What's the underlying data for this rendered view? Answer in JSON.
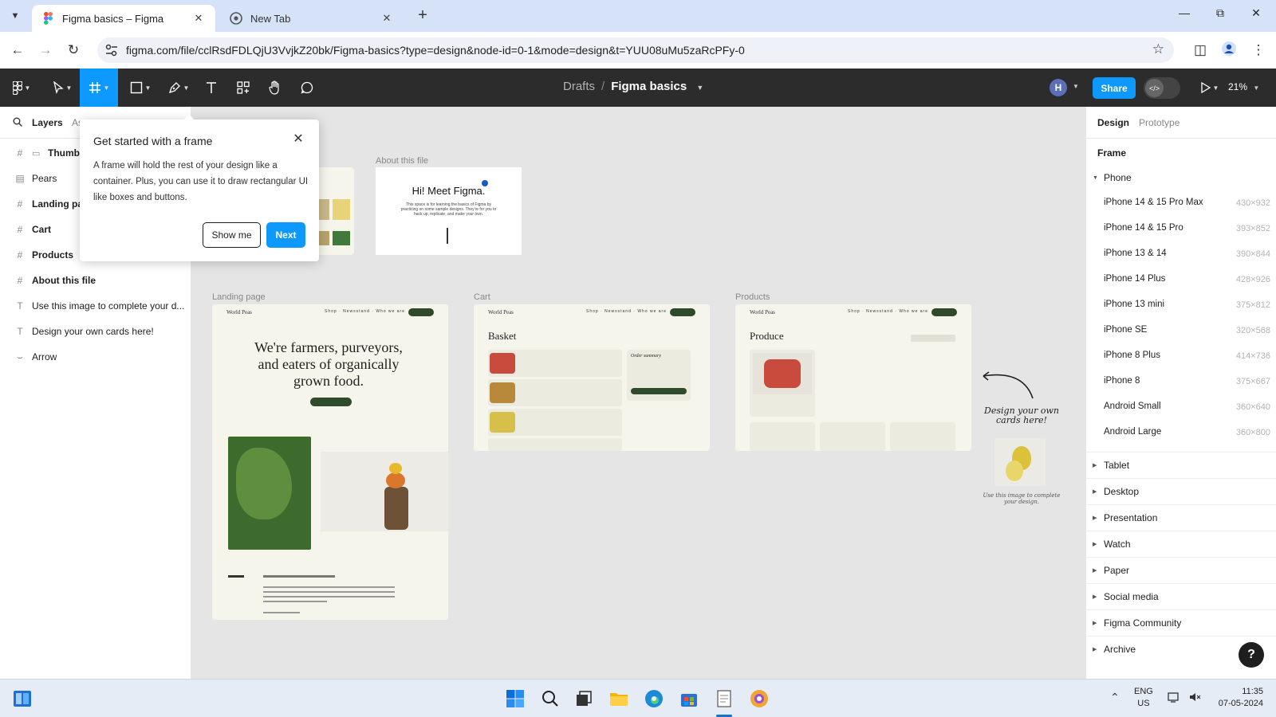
{
  "browser": {
    "tabs": [
      {
        "title": "Figma basics – Figma",
        "active": true
      },
      {
        "title": "New Tab",
        "active": false
      }
    ],
    "url": "figma.com/file/cclRsdFDLQjU3VvjkZ20bk/Figma-basics?type=design&node-id=0-1&mode=design&t=YUU08uMu5zaRcPFy-0"
  },
  "toolbar": {
    "breadcrumb_parent": "Drafts",
    "breadcrumb_separator": "/",
    "file_name": "Figma basics",
    "avatar_initial": "H",
    "share_label": "Share",
    "zoom": "21%",
    "accent": "#0d99ff"
  },
  "left_panel": {
    "layers_tab": "Layers",
    "assets_tab": "As",
    "layers": [
      {
        "icon": "frame-icon",
        "label": "Thumb",
        "bold": true
      },
      {
        "icon": "image-icon",
        "label": "Pears",
        "bold": false
      },
      {
        "icon": "frame-icon",
        "label": "Landing pa",
        "bold": true
      },
      {
        "icon": "frame-icon",
        "label": "Cart",
        "bold": true
      },
      {
        "icon": "frame-icon",
        "label": "Products",
        "bold": true
      },
      {
        "icon": "frame-icon",
        "label": "About this file",
        "bold": true
      },
      {
        "icon": "text-icon",
        "label": "Use this image to complete your d...",
        "bold": false
      },
      {
        "icon": "text-icon",
        "label": "Design your own cards here!",
        "bold": false
      },
      {
        "icon": "vector-icon",
        "label": "Arrow",
        "bold": false
      }
    ]
  },
  "popup": {
    "title": "Get started with a frame",
    "body": "A frame will hold the rest of your design like a container. Plus, you can use it to draw rectangular UI like boxes and buttons.",
    "show_me": "Show me",
    "next": "Next"
  },
  "canvas": {
    "about_label": "About this file",
    "about_title": "Hi! Meet Figma.",
    "about_body": "This space is for learning the basics of Figma by practicing on some sample designs. They're for you to hack up, replicate, and make your own.",
    "landing_label": "Landing page",
    "cart_label": "Cart",
    "products_label": "Products",
    "brand": "World Peas",
    "hero_line1": "We're farmers, purveyors,",
    "hero_line2": "and eaters of organically",
    "hero_line3": "grown food.",
    "basket_title": "Basket",
    "order_summary": "Order summary",
    "produce_title": "Produce",
    "cards_note": "Design your own cards here!",
    "image_note": "Use this image to complete your design."
  },
  "right_panel": {
    "design_tab": "Design",
    "prototype_tab": "Prototype",
    "section": "Frame",
    "expanded_category": "Phone",
    "presets": [
      {
        "name": "iPhone 14 & 15 Pro Max",
        "size": "430×932"
      },
      {
        "name": "iPhone 14 & 15 Pro",
        "size": "393×852"
      },
      {
        "name": "iPhone 13 & 14",
        "size": "390×844"
      },
      {
        "name": "iPhone 14 Plus",
        "size": "428×926"
      },
      {
        "name": "iPhone 13 mini",
        "size": "375×812"
      },
      {
        "name": "iPhone SE",
        "size": "320×568"
      },
      {
        "name": "iPhone 8 Plus",
        "size": "414×736"
      },
      {
        "name": "iPhone 8",
        "size": "375×667"
      },
      {
        "name": "Android Small",
        "size": "360×640"
      },
      {
        "name": "Android Large",
        "size": "360×800"
      }
    ],
    "categories": [
      "Tablet",
      "Desktop",
      "Presentation",
      "Watch",
      "Paper",
      "Social media",
      "Figma Community",
      "Archive"
    ],
    "help": "?"
  },
  "taskbar": {
    "lang": "ENG",
    "region": "US",
    "time": "11:35",
    "date": "07-05-2024"
  }
}
